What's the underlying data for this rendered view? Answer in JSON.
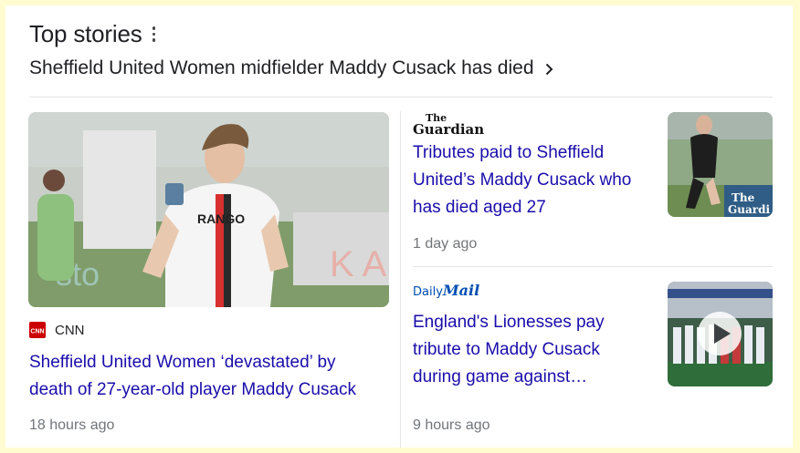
{
  "section": {
    "title": "Top stories",
    "headline": "Sheffield United Women midfielder Maddy Cusack has died"
  },
  "stories": [
    {
      "source": "CNN",
      "source_logo_text": "CNN",
      "title_line1": "Sheffield United Women ‘devastated’ by",
      "title_line2": "death of 27-year-old player Maddy Cusack",
      "time": "18 hours ago",
      "image_text": "RANGO"
    },
    {
      "source": "The Guardian",
      "logo_line1": "The",
      "logo_line2": "Guardian",
      "title_line1": "Tributes paid to Sheffield",
      "title_line2": "United’s Maddy Cusack who",
      "title_line3": "has died aged 27",
      "time": "1 day ago",
      "thumb_text_1": "The",
      "thumb_text_2": "Guardi"
    },
    {
      "source": "Daily Mail",
      "logo_daily": "Daily",
      "logo_mail": "Mail",
      "title_line1": "England's Lionesses pay",
      "title_line2": "tribute to Maddy Cusack",
      "title_line3": "during game against…",
      "time": "9 hours ago"
    }
  ],
  "colors": {
    "link": "#1a0dab",
    "meta": "#70757a",
    "page_bg": "#fefcd0",
    "cnn_red": "#cc0000",
    "daily_mail_blue": "#004db3"
  },
  "icons": [
    "more-vert-icon",
    "chevron-right-icon",
    "cnn-logo-icon",
    "guardian-logo-icon",
    "daily-mail-logo-icon",
    "play-icon"
  ]
}
